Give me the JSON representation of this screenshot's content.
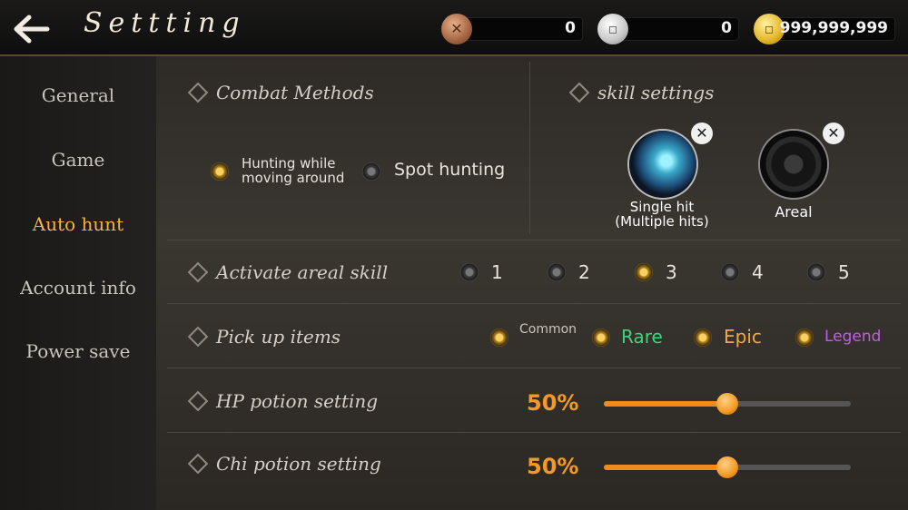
{
  "header": {
    "title": "Settting",
    "currencies": [
      {
        "name": "copper-token",
        "amount": "0",
        "color": "#a36440"
      },
      {
        "name": "silver-coin",
        "amount": "0",
        "color": "#c6c6c6"
      },
      {
        "name": "gold-coin",
        "amount": "999,999,999",
        "color": "#e3b526"
      }
    ]
  },
  "sidebar": {
    "items": [
      {
        "label": "General",
        "active": false
      },
      {
        "label": "Game",
        "active": false
      },
      {
        "label": "Auto hunt",
        "active": true
      },
      {
        "label": "Account info",
        "active": false
      },
      {
        "label": "Power save",
        "active": false
      }
    ],
    "active_color": "#f3b53a"
  },
  "combat": {
    "title": "Combat Methods",
    "options": [
      {
        "label_line1": "Hunting while",
        "label_line2": "moving around",
        "selected": true
      },
      {
        "label": "Spot hunting",
        "selected": false
      }
    ]
  },
  "skills": {
    "title": "skill settings",
    "slots": [
      {
        "icon": "blade-skill-icon",
        "label_line1": "Single hit",
        "label_line2": "(Multiple hits)"
      },
      {
        "icon": "areal-skill-icon",
        "label": "Areal"
      }
    ]
  },
  "areal": {
    "title": "Activate areal skill",
    "options": [
      {
        "label": "1",
        "selected": false
      },
      {
        "label": "2",
        "selected": false
      },
      {
        "label": "3",
        "selected": true
      },
      {
        "label": "4",
        "selected": false
      },
      {
        "label": "5",
        "selected": false
      }
    ]
  },
  "pickup": {
    "title": "Pick up items",
    "options": [
      {
        "label": "Common",
        "selected": true,
        "color": "#c9c5bd"
      },
      {
        "label": "Rare",
        "selected": true,
        "color": "#3fd47a"
      },
      {
        "label": "Epic",
        "selected": true,
        "color": "#f2a93a"
      },
      {
        "label": "Legend",
        "selected": true,
        "color": "#c55ae6"
      }
    ]
  },
  "hp_potion": {
    "title": "HP potion setting",
    "value_text": "50%",
    "level": 0.5
  },
  "chi_potion": {
    "title": "Chi potion setting",
    "value_text": "50%",
    "level": 0.5
  }
}
